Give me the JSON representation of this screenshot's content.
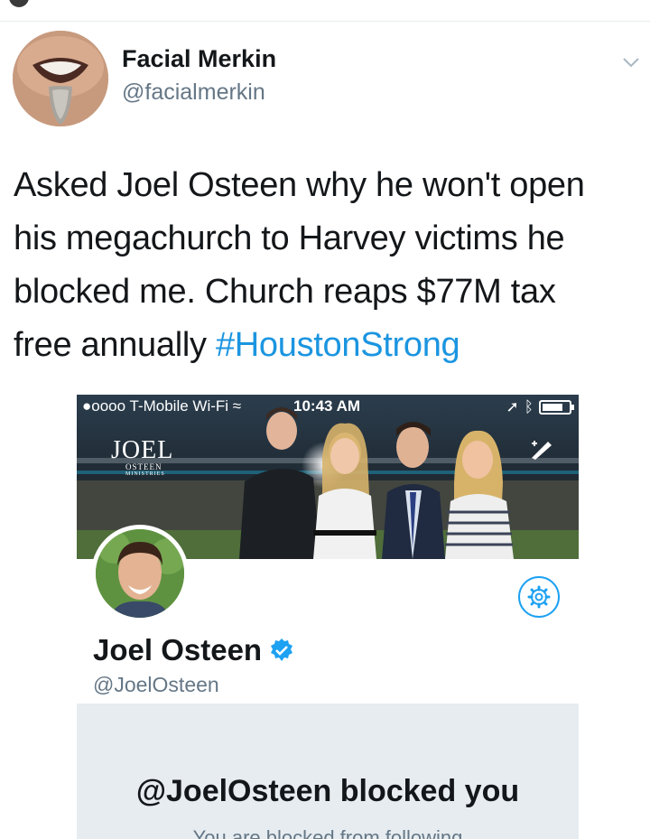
{
  "tweet": {
    "author_name": "Facial Merkin",
    "author_handle": "@facialmerkin",
    "text_lines": [
      "Asked Joel Osteen why he won't open",
      "his megachurch to Harvey victims he",
      "blocked me. Church reaps $77M tax",
      "free annually "
    ],
    "hashtag": "#HoustonStrong"
  },
  "embedded_screenshot": {
    "status_bar": {
      "carrier": "●oooo T-Mobile Wi-Fi ",
      "time": "10:43 AM"
    },
    "banner_logo": {
      "main": "JOEL",
      "sub": "OSTEEN",
      "sub2": "MINISTRIES"
    },
    "profile": {
      "name": "Joel Osteen",
      "handle": "@JoelOsteen"
    },
    "blocked": {
      "title": "@JoelOsteen blocked you",
      "subtitle": "You are blocked from following"
    }
  },
  "colors": {
    "link": "#1b95e0",
    "twitter_blue": "#1da1f2",
    "secondary_text": "#657786",
    "panel_bg": "#e6ecf0"
  },
  "icons": [
    "chevron-down-icon",
    "wifi-icon",
    "location-arrow-icon",
    "bluetooth-icon",
    "battery-icon",
    "compose-icon",
    "gear-icon",
    "verified-icon"
  ]
}
